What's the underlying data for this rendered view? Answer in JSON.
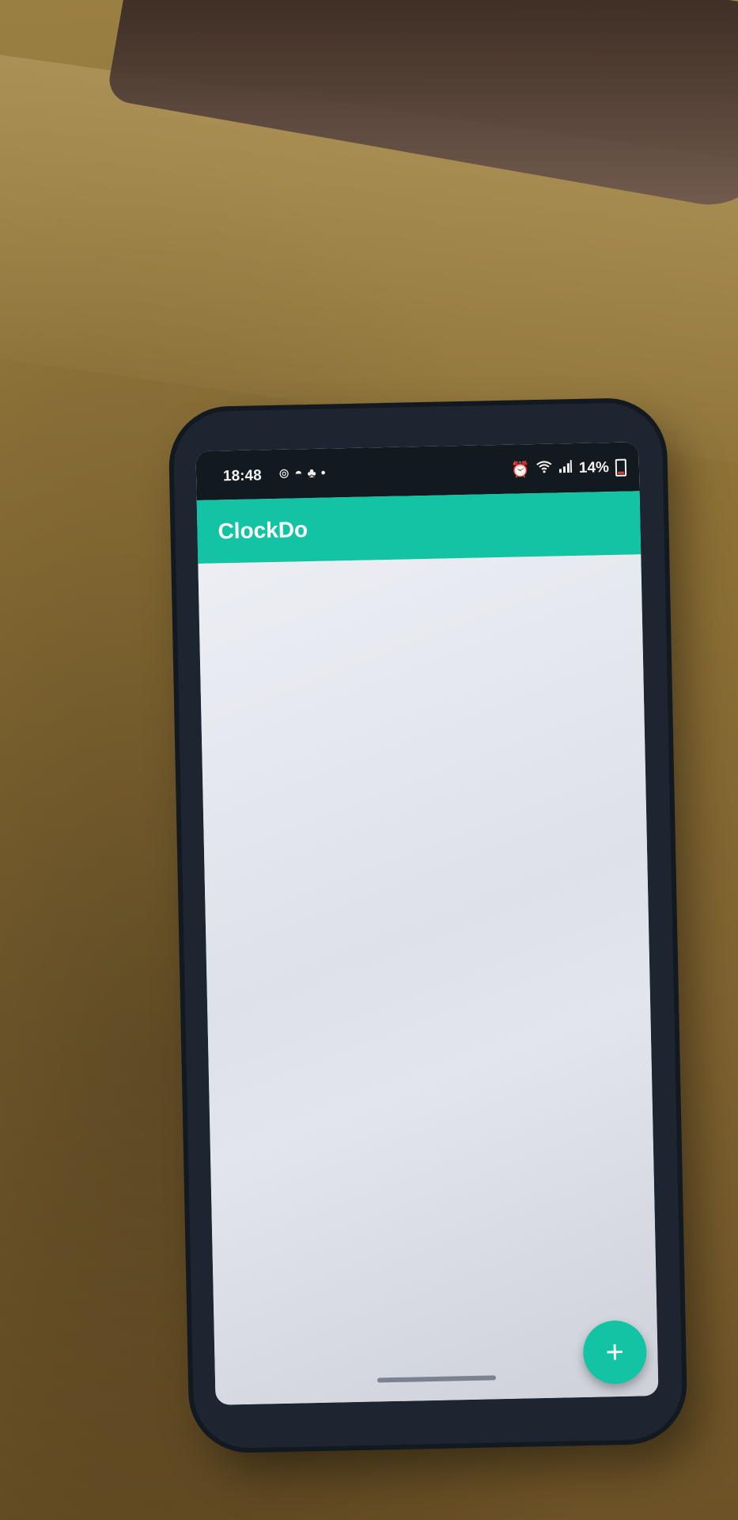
{
  "status_bar": {
    "time": "18:48",
    "left_icons": [
      "sync-icon",
      "pokeball-icon",
      "tree-icon",
      "dot-icon"
    ],
    "right_icons": [
      "alarm-icon",
      "wifi-icon",
      "signal-icon"
    ],
    "battery": "14%"
  },
  "app": {
    "title": "ClockDo",
    "accent_color": "#12c4a4"
  },
  "fab": {
    "icon": "plus-icon",
    "glyph": "+"
  }
}
